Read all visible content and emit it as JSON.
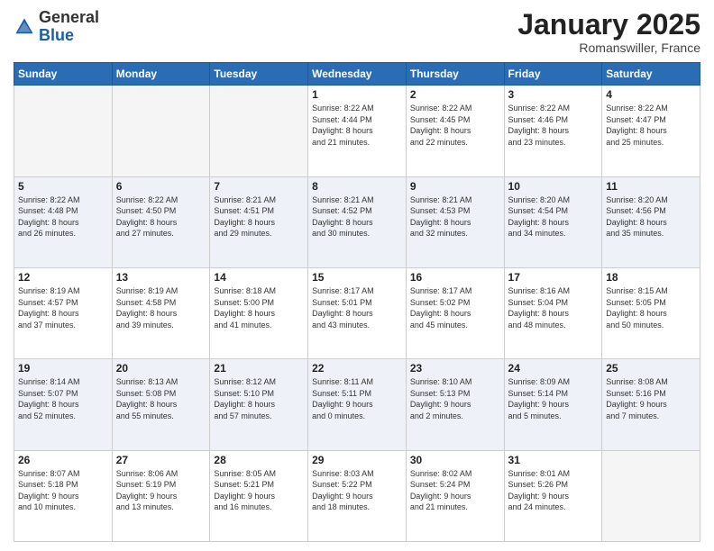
{
  "header": {
    "logo_general": "General",
    "logo_blue": "Blue",
    "month_title": "January 2025",
    "location": "Romanswiller, France"
  },
  "weekdays": [
    "Sunday",
    "Monday",
    "Tuesday",
    "Wednesday",
    "Thursday",
    "Friday",
    "Saturday"
  ],
  "weeks": [
    [
      {
        "day": "",
        "info": ""
      },
      {
        "day": "",
        "info": ""
      },
      {
        "day": "",
        "info": ""
      },
      {
        "day": "1",
        "info": "Sunrise: 8:22 AM\nSunset: 4:44 PM\nDaylight: 8 hours\nand 21 minutes."
      },
      {
        "day": "2",
        "info": "Sunrise: 8:22 AM\nSunset: 4:45 PM\nDaylight: 8 hours\nand 22 minutes."
      },
      {
        "day": "3",
        "info": "Sunrise: 8:22 AM\nSunset: 4:46 PM\nDaylight: 8 hours\nand 23 minutes."
      },
      {
        "day": "4",
        "info": "Sunrise: 8:22 AM\nSunset: 4:47 PM\nDaylight: 8 hours\nand 25 minutes."
      }
    ],
    [
      {
        "day": "5",
        "info": "Sunrise: 8:22 AM\nSunset: 4:48 PM\nDaylight: 8 hours\nand 26 minutes."
      },
      {
        "day": "6",
        "info": "Sunrise: 8:22 AM\nSunset: 4:50 PM\nDaylight: 8 hours\nand 27 minutes."
      },
      {
        "day": "7",
        "info": "Sunrise: 8:21 AM\nSunset: 4:51 PM\nDaylight: 8 hours\nand 29 minutes."
      },
      {
        "day": "8",
        "info": "Sunrise: 8:21 AM\nSunset: 4:52 PM\nDaylight: 8 hours\nand 30 minutes."
      },
      {
        "day": "9",
        "info": "Sunrise: 8:21 AM\nSunset: 4:53 PM\nDaylight: 8 hours\nand 32 minutes."
      },
      {
        "day": "10",
        "info": "Sunrise: 8:20 AM\nSunset: 4:54 PM\nDaylight: 8 hours\nand 34 minutes."
      },
      {
        "day": "11",
        "info": "Sunrise: 8:20 AM\nSunset: 4:56 PM\nDaylight: 8 hours\nand 35 minutes."
      }
    ],
    [
      {
        "day": "12",
        "info": "Sunrise: 8:19 AM\nSunset: 4:57 PM\nDaylight: 8 hours\nand 37 minutes."
      },
      {
        "day": "13",
        "info": "Sunrise: 8:19 AM\nSunset: 4:58 PM\nDaylight: 8 hours\nand 39 minutes."
      },
      {
        "day": "14",
        "info": "Sunrise: 8:18 AM\nSunset: 5:00 PM\nDaylight: 8 hours\nand 41 minutes."
      },
      {
        "day": "15",
        "info": "Sunrise: 8:17 AM\nSunset: 5:01 PM\nDaylight: 8 hours\nand 43 minutes."
      },
      {
        "day": "16",
        "info": "Sunrise: 8:17 AM\nSunset: 5:02 PM\nDaylight: 8 hours\nand 45 minutes."
      },
      {
        "day": "17",
        "info": "Sunrise: 8:16 AM\nSunset: 5:04 PM\nDaylight: 8 hours\nand 48 minutes."
      },
      {
        "day": "18",
        "info": "Sunrise: 8:15 AM\nSunset: 5:05 PM\nDaylight: 8 hours\nand 50 minutes."
      }
    ],
    [
      {
        "day": "19",
        "info": "Sunrise: 8:14 AM\nSunset: 5:07 PM\nDaylight: 8 hours\nand 52 minutes."
      },
      {
        "day": "20",
        "info": "Sunrise: 8:13 AM\nSunset: 5:08 PM\nDaylight: 8 hours\nand 55 minutes."
      },
      {
        "day": "21",
        "info": "Sunrise: 8:12 AM\nSunset: 5:10 PM\nDaylight: 8 hours\nand 57 minutes."
      },
      {
        "day": "22",
        "info": "Sunrise: 8:11 AM\nSunset: 5:11 PM\nDaylight: 9 hours\nand 0 minutes."
      },
      {
        "day": "23",
        "info": "Sunrise: 8:10 AM\nSunset: 5:13 PM\nDaylight: 9 hours\nand 2 minutes."
      },
      {
        "day": "24",
        "info": "Sunrise: 8:09 AM\nSunset: 5:14 PM\nDaylight: 9 hours\nand 5 minutes."
      },
      {
        "day": "25",
        "info": "Sunrise: 8:08 AM\nSunset: 5:16 PM\nDaylight: 9 hours\nand 7 minutes."
      }
    ],
    [
      {
        "day": "26",
        "info": "Sunrise: 8:07 AM\nSunset: 5:18 PM\nDaylight: 9 hours\nand 10 minutes."
      },
      {
        "day": "27",
        "info": "Sunrise: 8:06 AM\nSunset: 5:19 PM\nDaylight: 9 hours\nand 13 minutes."
      },
      {
        "day": "28",
        "info": "Sunrise: 8:05 AM\nSunset: 5:21 PM\nDaylight: 9 hours\nand 16 minutes."
      },
      {
        "day": "29",
        "info": "Sunrise: 8:03 AM\nSunset: 5:22 PM\nDaylight: 9 hours\nand 18 minutes."
      },
      {
        "day": "30",
        "info": "Sunrise: 8:02 AM\nSunset: 5:24 PM\nDaylight: 9 hours\nand 21 minutes."
      },
      {
        "day": "31",
        "info": "Sunrise: 8:01 AM\nSunset: 5:26 PM\nDaylight: 9 hours\nand 24 minutes."
      },
      {
        "day": "",
        "info": ""
      }
    ]
  ]
}
